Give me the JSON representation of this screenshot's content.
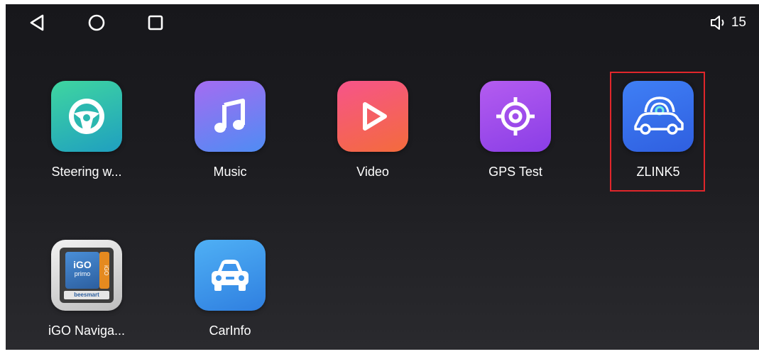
{
  "navbar": {
    "back_icon": "triangle-back-icon",
    "home_icon": "circle-home-icon",
    "recents_icon": "square-recents-icon",
    "volume_icon": "speaker-icon",
    "volume_level": "15"
  },
  "apps": [
    {
      "label": "Steering w...",
      "icon": "steering-wheel-icon",
      "colors": [
        "#3fd6a0",
        "#1f9fc0"
      ]
    },
    {
      "label": "Music",
      "icon": "music-note-icon",
      "colors": [
        "#a46cf2",
        "#4f8cf3"
      ]
    },
    {
      "label": "Video",
      "icon": "play-icon",
      "colors": [
        "#f6548a",
        "#f46b3c"
      ]
    },
    {
      "label": "GPS Test",
      "icon": "target-icon",
      "colors": [
        "#b45cf0",
        "#8a3ee6"
      ]
    },
    {
      "label": "ZLINK5",
      "icon": "car-link-icon",
      "colors": [
        "#3f7ff5",
        "#2f5fe0"
      ]
    },
    {
      "label": "iGO Naviga...",
      "icon": "igo-app-icon",
      "colors": [
        "#e6e6e6",
        "#bdbdbd"
      ]
    },
    {
      "label": "CarInfo",
      "icon": "car-icon",
      "colors": [
        "#4fb0f5",
        "#2f7fe0"
      ]
    }
  ],
  "igo_icon": {
    "line1": "iGO",
    "line2": "primo",
    "footer": "beesmart",
    "side": "iGO"
  },
  "highlight_color": "#e0262b"
}
